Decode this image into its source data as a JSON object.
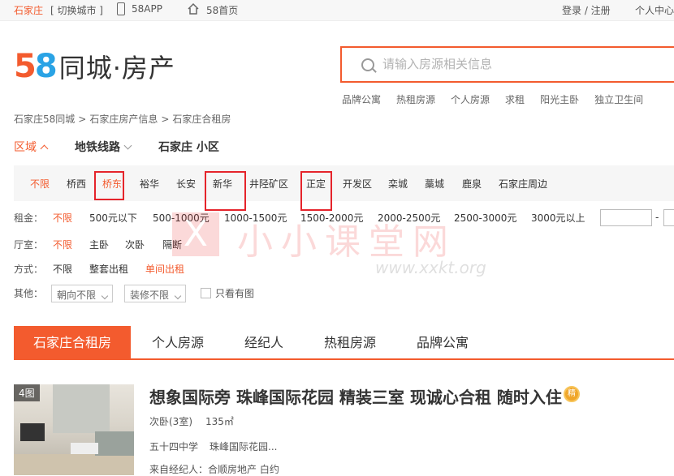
{
  "topbar": {
    "city": "石家庄",
    "switch_city": "[ 切换城市 ]",
    "app": "58APP",
    "home": "58首页",
    "login": "登录 / 注册",
    "user_center": "个人中心"
  },
  "logo": {
    "num5": "5",
    "num8": "8",
    "text": "同城·房产"
  },
  "search": {
    "placeholder": "请输入房源相关信息"
  },
  "hot_links": [
    "品牌公寓",
    "热租房源",
    "个人房源",
    "求租",
    "阳光主卧",
    "独立卫生间"
  ],
  "breadcrumb": [
    "石家庄58同城",
    "石家庄房产信息",
    "石家庄合租房"
  ],
  "breadcrumb_sep": ">",
  "filter_tabs": [
    "区域",
    "地铁线路",
    "石家庄 小区"
  ],
  "regions": [
    "不限",
    "桥西",
    "桥东",
    "裕华",
    "长安",
    "新华",
    "井陉矿区",
    "正定",
    "开发区",
    "栾城",
    "藁城",
    "鹿泉",
    "石家庄周边"
  ],
  "rent": {
    "label": "租金：",
    "options": [
      "不限",
      "500元以下",
      "500-1000元",
      "1000-1500元",
      "1500-2000元",
      "2000-2500元",
      "2500-3000元",
      "3000元以上"
    ],
    "dash": "-"
  },
  "room": {
    "label": "厅室：",
    "options": [
      "不限",
      "主卧",
      "次卧",
      "隔断"
    ]
  },
  "mode": {
    "label": "方式：",
    "options": [
      "不限",
      "整套出租",
      "单间出租"
    ]
  },
  "other": {
    "label": "其他：",
    "orientation": "朝向不限",
    "decoration": "装修不限",
    "only_photos": "只看有图"
  },
  "watermark": {
    "x": "X",
    "text": "小小课堂网",
    "url": "www.xxkt.org"
  },
  "list_tabs": [
    "石家庄合租房",
    "个人房源",
    "经纪人",
    "热租房源",
    "品牌公寓"
  ],
  "listing": {
    "photo_count": "4图",
    "title": "想象国际旁 珠峰国际花园 精装三室 现诚心合租 随时入住",
    "badge": "精",
    "room": "次卧(3室)",
    "area": "135㎡",
    "location_1": "五十四中学",
    "location_2": "珠峰国际花园...",
    "agent": "来自经纪人：合顺房地产 白约"
  },
  "colors": {
    "accent": "#f35b2e",
    "highlight_box": "#e5242b",
    "logo_blue": "#2aa3e5"
  }
}
